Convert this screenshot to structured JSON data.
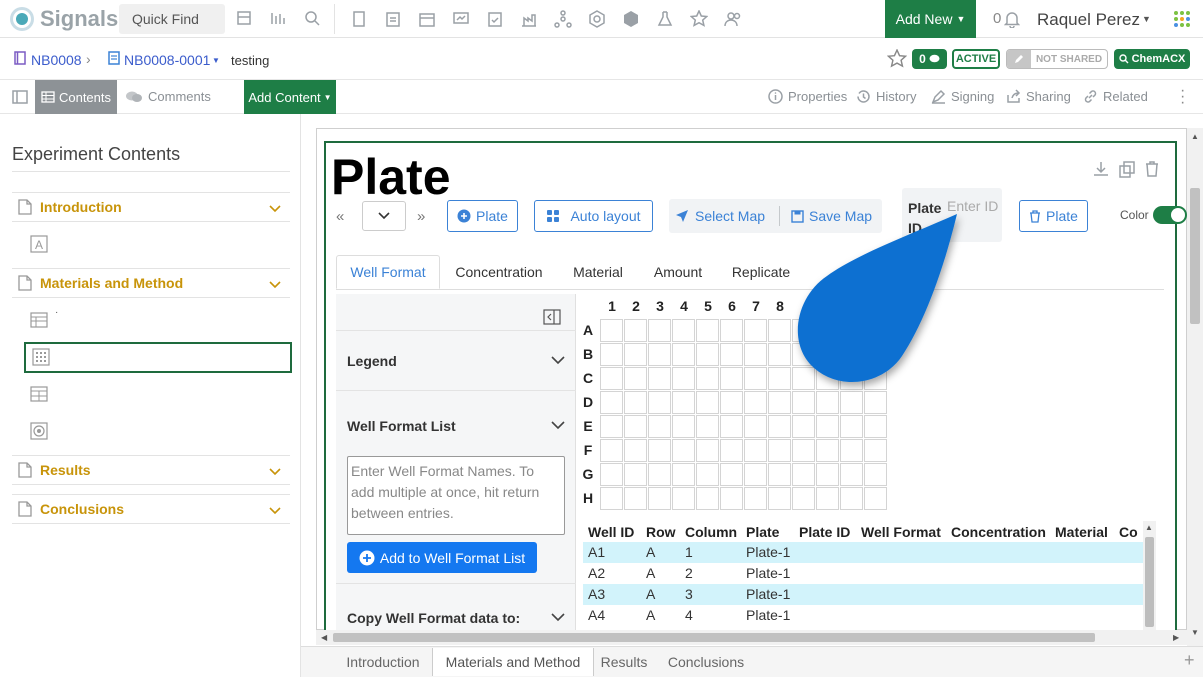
{
  "app": {
    "name": "Signals",
    "quick_find": "Quick Find",
    "add_new": "Add New",
    "notifications": "0",
    "user": "Raquel Perez"
  },
  "colors": {
    "brand_green": "#1e7e46",
    "accent_blue": "#3b82d6",
    "section_gold": "#c8940a",
    "cursor_blue": "#0a6fd1",
    "row_highlight": "#d2f3fb"
  },
  "breadcrumb": {
    "notebook": "NB0008",
    "experiment": "NB0008-0001",
    "name": "testing"
  },
  "badges": {
    "comments": "0",
    "active": "ACTIVE",
    "not_shared": "NOT SHARED",
    "chemacx": "ChemACX"
  },
  "toolbar": {
    "contents": "Contents",
    "comments": "Comments",
    "add_content": "Add Content",
    "properties": "Properties",
    "history": "History",
    "signing": "Signing",
    "sharing": "Sharing",
    "related": "Related"
  },
  "sidebar": {
    "title": "Experiment Contents",
    "sections": [
      {
        "label": "Introduction"
      },
      {
        "label": "Materials and Method"
      },
      {
        "label": "Results"
      },
      {
        "label": "Conclusions"
      }
    ],
    "small_mark": "·"
  },
  "plate": {
    "title": "Plate",
    "add_plate": "Plate",
    "auto_layout": "Auto layout",
    "select_map": "Select Map",
    "save_map": "Save Map",
    "plate_id_label": "Plate ID",
    "plate_id_placeholder": "Enter ID",
    "delete_plate": "Plate",
    "color_label": "Color",
    "tabs": [
      "Well Format",
      "Concentration",
      "Material",
      "Amount",
      "Replicate"
    ],
    "legend": "Legend",
    "well_format_list": "Well Format List",
    "textarea_placeholder": "Enter Well Format Names. To add multiple at once, hit return between entries.",
    "add_to_list": "Add to Well Format List",
    "copy_label": "Copy Well Format data to:",
    "columns": [
      "1",
      "2",
      "3",
      "4",
      "5",
      "6",
      "7",
      "8"
    ],
    "rows": [
      "A",
      "B",
      "C",
      "D",
      "E",
      "F",
      "G",
      "H"
    ]
  },
  "well_table": {
    "headers": [
      "Well ID",
      "Row",
      "Column",
      "Plate",
      "Plate ID",
      "Well Format",
      "Concentration",
      "Material",
      "Co"
    ],
    "rows": [
      [
        "A1",
        "A",
        "1",
        "Plate-1"
      ],
      [
        "A2",
        "A",
        "2",
        "Plate-1"
      ],
      [
        "A3",
        "A",
        "3",
        "Plate-1"
      ],
      [
        "A4",
        "A",
        "4",
        "Plate-1"
      ]
    ]
  },
  "bottom_tabs": [
    "Introduction",
    "Materials and Method",
    "Results",
    "Conclusions"
  ]
}
